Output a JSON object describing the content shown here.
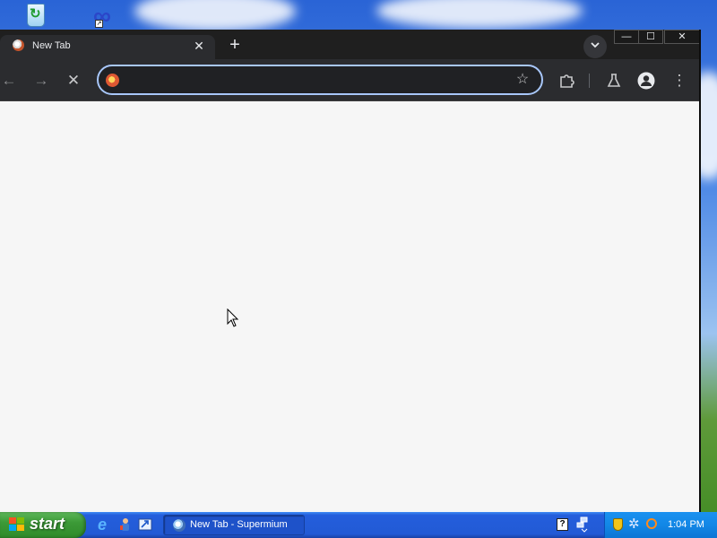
{
  "browser": {
    "tab": {
      "title": "New Tab",
      "favicon": "browser-favicon-icon",
      "close_glyph": "✕"
    },
    "new_tab_glyph": "+",
    "window_controls": {
      "minimize": "—",
      "maximize": "☐",
      "close": "✕"
    },
    "toolbar": {
      "back_glyph": "←",
      "forward_glyph": "→",
      "stop_glyph": "✕",
      "omnibox": {
        "value": "",
        "placeholder": "",
        "site_icon": "duckduckgo-icon"
      },
      "star_glyph": "☆",
      "menu_glyph": "⋮"
    },
    "colors": {
      "frame": "#202124",
      "toolbar": "#2b2c2f",
      "omnibox_focus": "#a8c7fa",
      "content_bg": "#f6f6f6"
    }
  },
  "taskbar": {
    "start_label": "start",
    "active_window": "New Tab - Supermium",
    "clock": "1:04 PM",
    "help_glyph": "?",
    "quick_launch": [
      "internet-explorer-icon",
      "media-icon",
      "desktop-icon"
    ],
    "tray_icons": [
      "shield-icon",
      "network-icon",
      "search-icon"
    ]
  },
  "desktop": {
    "icons": [
      "recycle-bin-icon",
      "shortcut-icon"
    ]
  }
}
